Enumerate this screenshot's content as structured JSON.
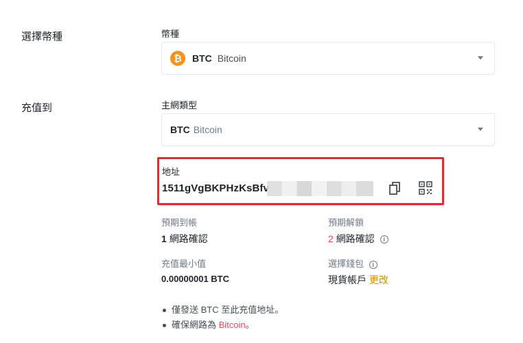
{
  "sections": {
    "coin_label": "選擇幣種",
    "deposit_label": "充值到"
  },
  "coin": {
    "field_label": "幣種",
    "icon_glyph": "₿",
    "symbol": "BTC",
    "name": "Bitcoin"
  },
  "network": {
    "field_label": "主網類型",
    "symbol": "BTC",
    "name": "Bitcoin"
  },
  "address": {
    "label": "地址",
    "value_visible": "1511gVgBKPHzKsBfv"
  },
  "info": {
    "expected_arrival_label": "預期到帳",
    "expected_arrival_num": "1",
    "expected_arrival_text": "網路確認",
    "expected_unlock_label": "預期解鎖",
    "expected_unlock_num": "2",
    "expected_unlock_text": "網路確認",
    "min_deposit_label": "充值最小值",
    "min_deposit_value": "0.00000001 BTC",
    "wallet_label": "選擇錢包",
    "wallet_value": "現貨帳戶",
    "wallet_change": "更改"
  },
  "notes": {
    "note1": "僅發送 BTC 至此充值地址。",
    "note2_prefix": "確保網路為 ",
    "note2_link": "Bitcoin",
    "note2_suffix": "。"
  },
  "colors": {
    "accent_gold": "#c99400",
    "alert_red": "#f6465d",
    "highlight_border": "#e02b35",
    "btc_orange": "#f7931a"
  }
}
